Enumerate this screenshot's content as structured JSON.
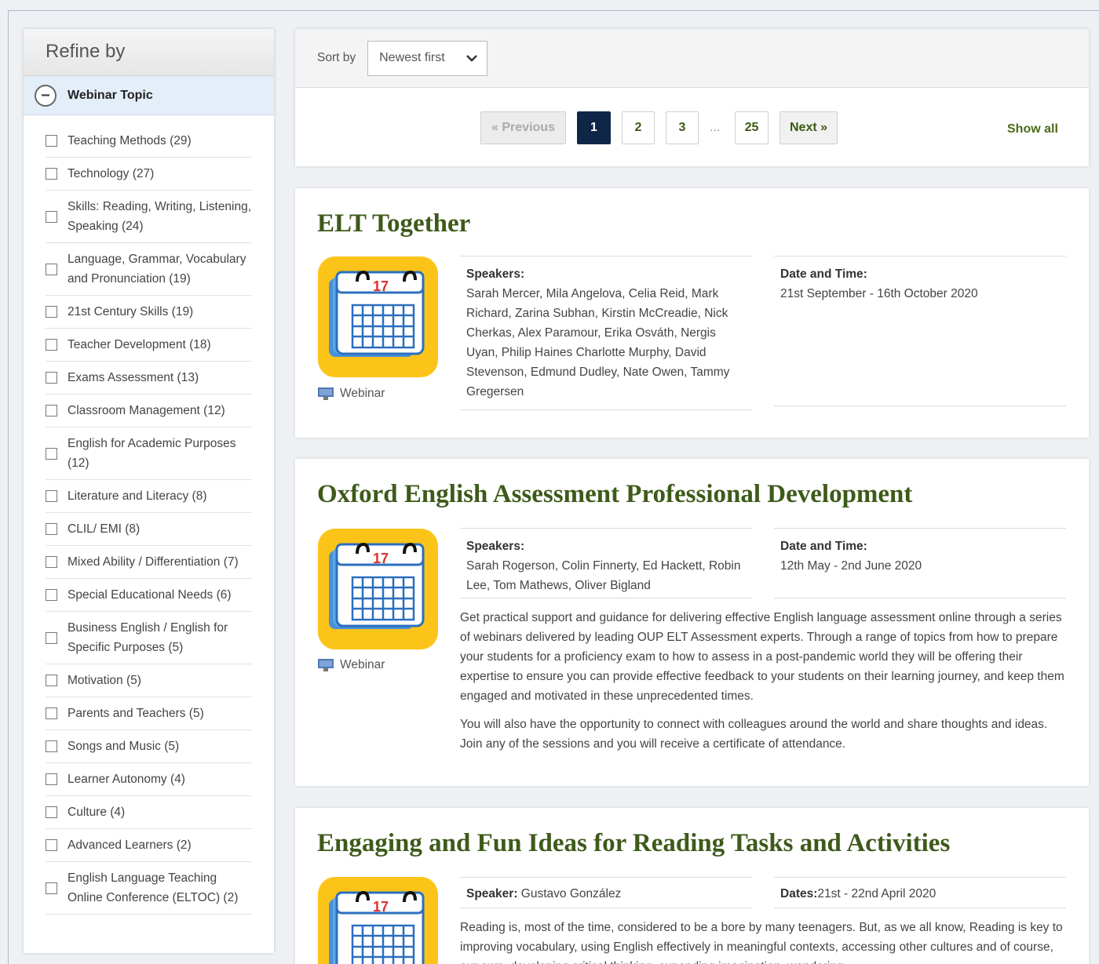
{
  "sidebar": {
    "title": "Refine by",
    "topic_header": "Webinar Topic",
    "filters": [
      "Teaching Methods (29)",
      "Technology (27)",
      "Skills: Reading, Writing, Listening, Speaking (24)",
      "Language, Grammar, Vocabulary and Pronunciation (19)",
      "21st Century Skills (19)",
      "Teacher Development (18)",
      "Exams Assessment (13)",
      "Classroom Management (12)",
      "English for Academic Purposes (12)",
      "Literature and Literacy (8)",
      "CLIL/ EMI (8)",
      "Mixed Ability / Differentiation (7)",
      "Special Educational Needs (6)",
      "Business English / English for Specific Purposes (5)",
      "Motivation (5)",
      "Parents and Teachers (5)",
      "Songs and Music (5)",
      "Learner Autonomy (4)",
      "Culture (4)",
      "Advanced Learners (2)",
      "English Language Teaching Online Conference (ELTOC) (2)"
    ]
  },
  "sort": {
    "label": "Sort by",
    "selected": "Newest first"
  },
  "pager": {
    "previous": "« Previous",
    "pages": [
      "1",
      "2",
      "3",
      "25"
    ],
    "ellipsis": "...",
    "next": "Next »",
    "show_all": "Show all",
    "current": "1"
  },
  "cards": [
    {
      "title": "ELT Together",
      "tag": "Webinar",
      "speakers_label": "Speakers:",
      "speakers": "Sarah Mercer, Mila Angelova, Celia Reid, Mark Richard, Zarina Subhan, Kirstin McCreadie, Nick Cherkas, Alex Paramour, Erika Osváth, Nergis Uyan, Philip Haines Charlotte Murphy, David Stevenson, Edmund Dudley, Nate Owen, Tammy Gregersen",
      "date_label": "Date and Time:",
      "date": "21st September - 16th October 2020"
    },
    {
      "title": "Oxford English Assessment Professional Development",
      "tag": "Webinar",
      "speakers_label": "Speakers:",
      "speakers": "Sarah Rogerson, Colin Finnerty, Ed Hackett, Robin Lee, Tom Mathews, Oliver Bigland",
      "date_label": "Date and Time:",
      "date": "12th May - 2nd June 2020",
      "desc1": "Get practical support and guidance for delivering effective English language assessment online through a series of webinars delivered by leading OUP ELT Assessment experts. Through a range of topics from how to prepare your students for a proficiency exam to how to assess in a post-pandemic world they will be offering their expertise to ensure you can provide effective feedback to your students on their learning journey, and keep them engaged and motivated in these unprecedented times.",
      "desc2": "You will also have the opportunity to connect with colleagues around the world and share thoughts and ideas. Join any of the sessions and you will receive a certificate of attendance."
    },
    {
      "title": "Engaging and Fun Ideas for Reading Tasks and Activities",
      "speaker_label": "Speaker:",
      "speaker": "Gustavo González",
      "date_label": "Dates:",
      "date": "21st - 22nd April 2020",
      "desc1": "Reading is, most of the time, considered to be a bore by many teenagers. But, as we all know, Reading is key to improving vocabulary, using English effectively in meaningful contexts, accessing other cultures and of course, our own, developing critical thinking, expanding imagination, wondering"
    }
  ],
  "icons": {
    "calendar_icon": "calendar-icon",
    "calendar_number": "17",
    "monitor_icon": "monitor-icon"
  }
}
